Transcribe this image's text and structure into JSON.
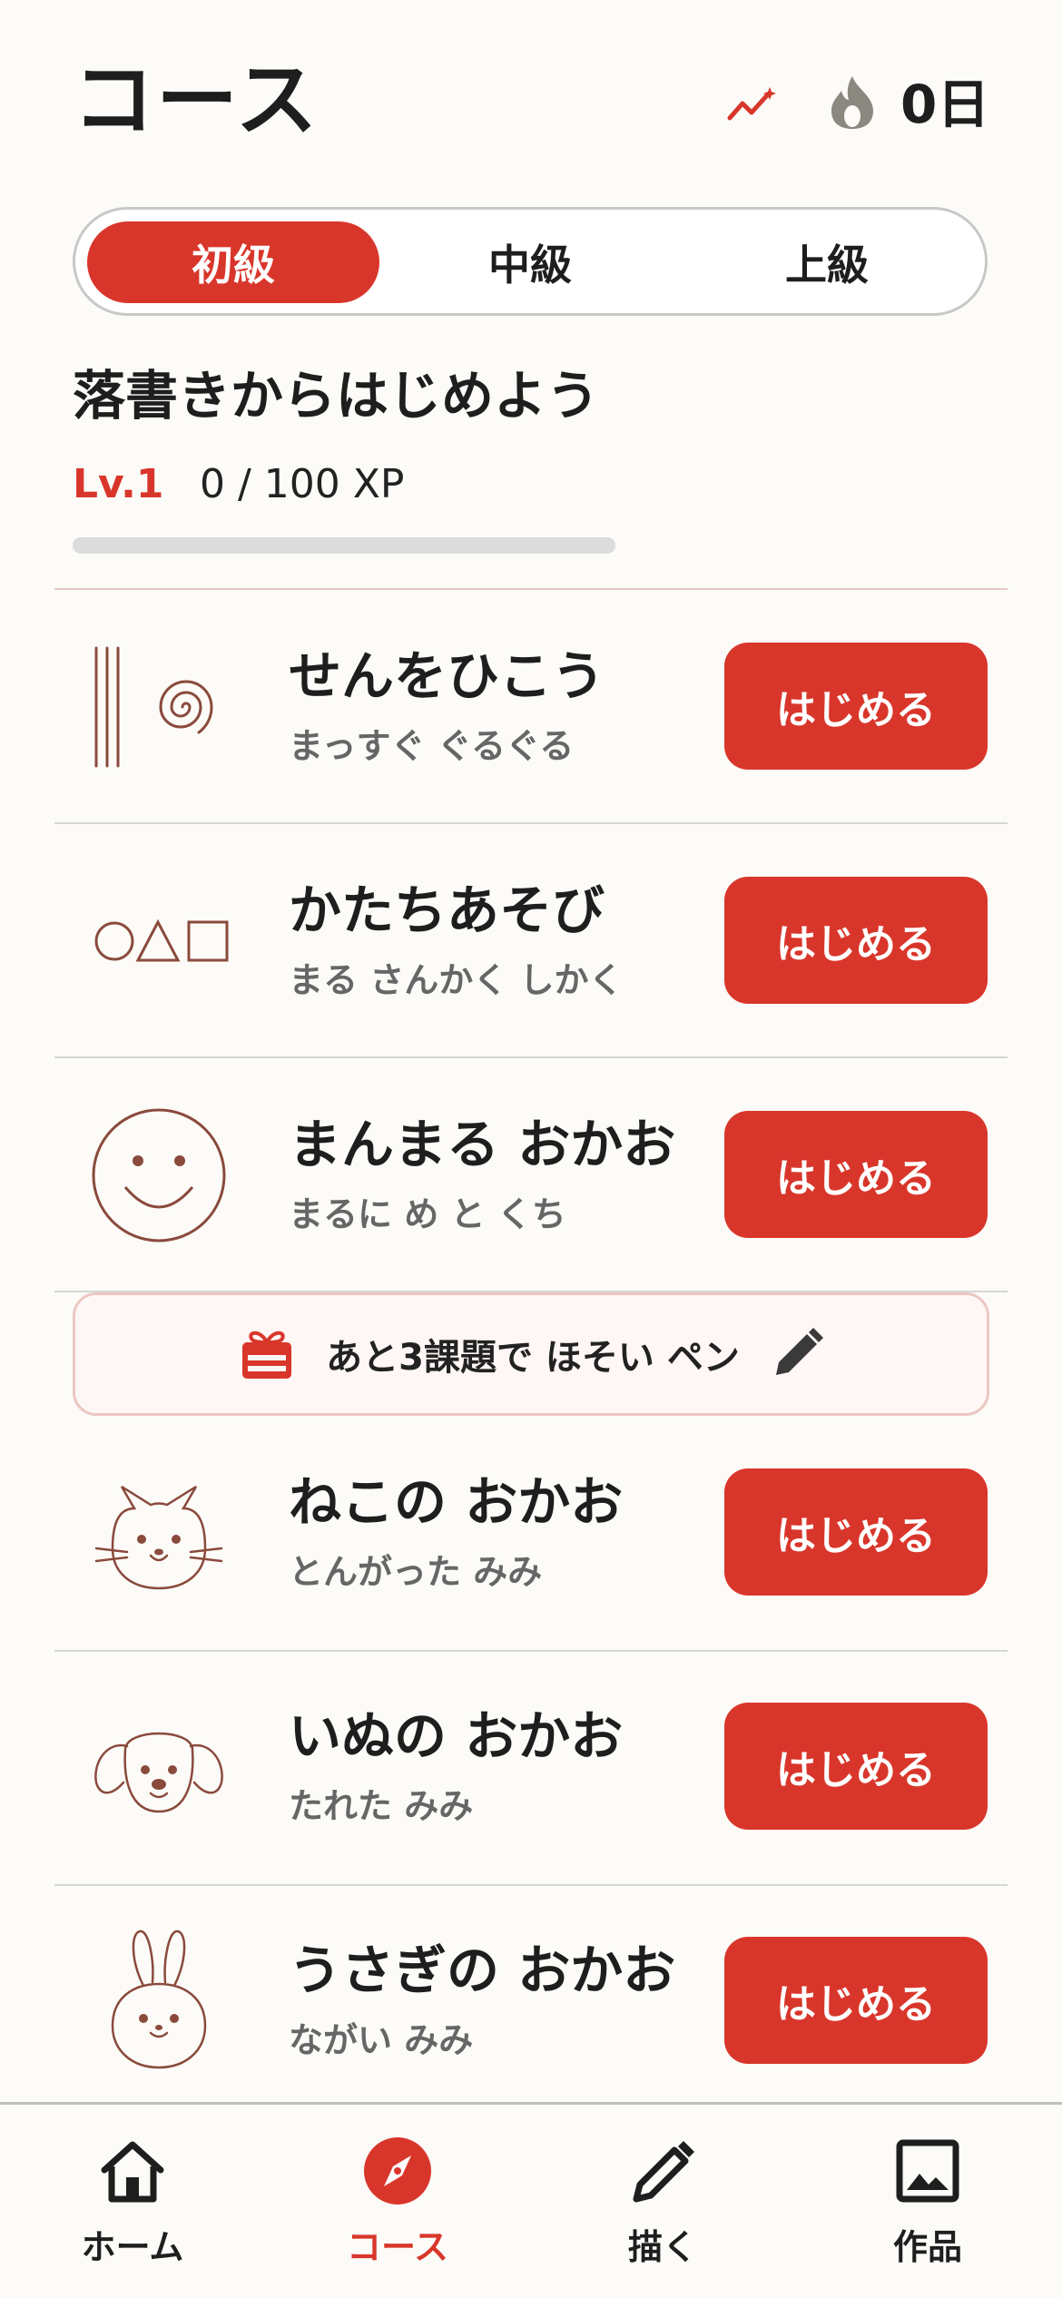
{
  "header": {
    "title": "コース",
    "streak": "0日"
  },
  "levels": [
    "初級",
    "中級",
    "上級"
  ],
  "section": {
    "heading": "落書きからはじめよう",
    "level": "Lv.1",
    "xp": "0 / 100 XP",
    "xp_progress": 0
  },
  "lessons": [
    {
      "title": "せんをひこう",
      "subtitle": "まっすぐ ぐるぐる",
      "button": "はじめる",
      "icon": "lines-spiral-icon"
    },
    {
      "title": "かたちあそび",
      "subtitle": "まる さんかく しかく",
      "button": "はじめる",
      "icon": "shapes-icon"
    },
    {
      "title": "まんまる おかお",
      "subtitle": "まるに め と くち",
      "button": "はじめる",
      "icon": "smiley-face-icon"
    },
    {
      "title": "ねこの おかお",
      "subtitle": "とんがった みみ",
      "button": "はじめる",
      "icon": "cat-face-icon"
    },
    {
      "title": "いぬの おかお",
      "subtitle": "たれた みみ",
      "button": "はじめる",
      "icon": "dog-face-icon"
    },
    {
      "title": "うさぎの おかお",
      "subtitle": "ながい みみ",
      "button": "はじめる",
      "icon": "rabbit-face-icon"
    }
  ],
  "reward_banner": {
    "text": "あと3課題で ほそい ペン"
  },
  "tabs": [
    {
      "label": "ホーム",
      "icon": "home-icon"
    },
    {
      "label": "コース",
      "icon": "compass-icon"
    },
    {
      "label": "描く",
      "icon": "pencil-icon"
    },
    {
      "label": "作品",
      "icon": "image-icon"
    }
  ],
  "colors": {
    "accent": "#d9362b",
    "background": "#fcfbf8",
    "drawing": "#8a4a3c"
  }
}
